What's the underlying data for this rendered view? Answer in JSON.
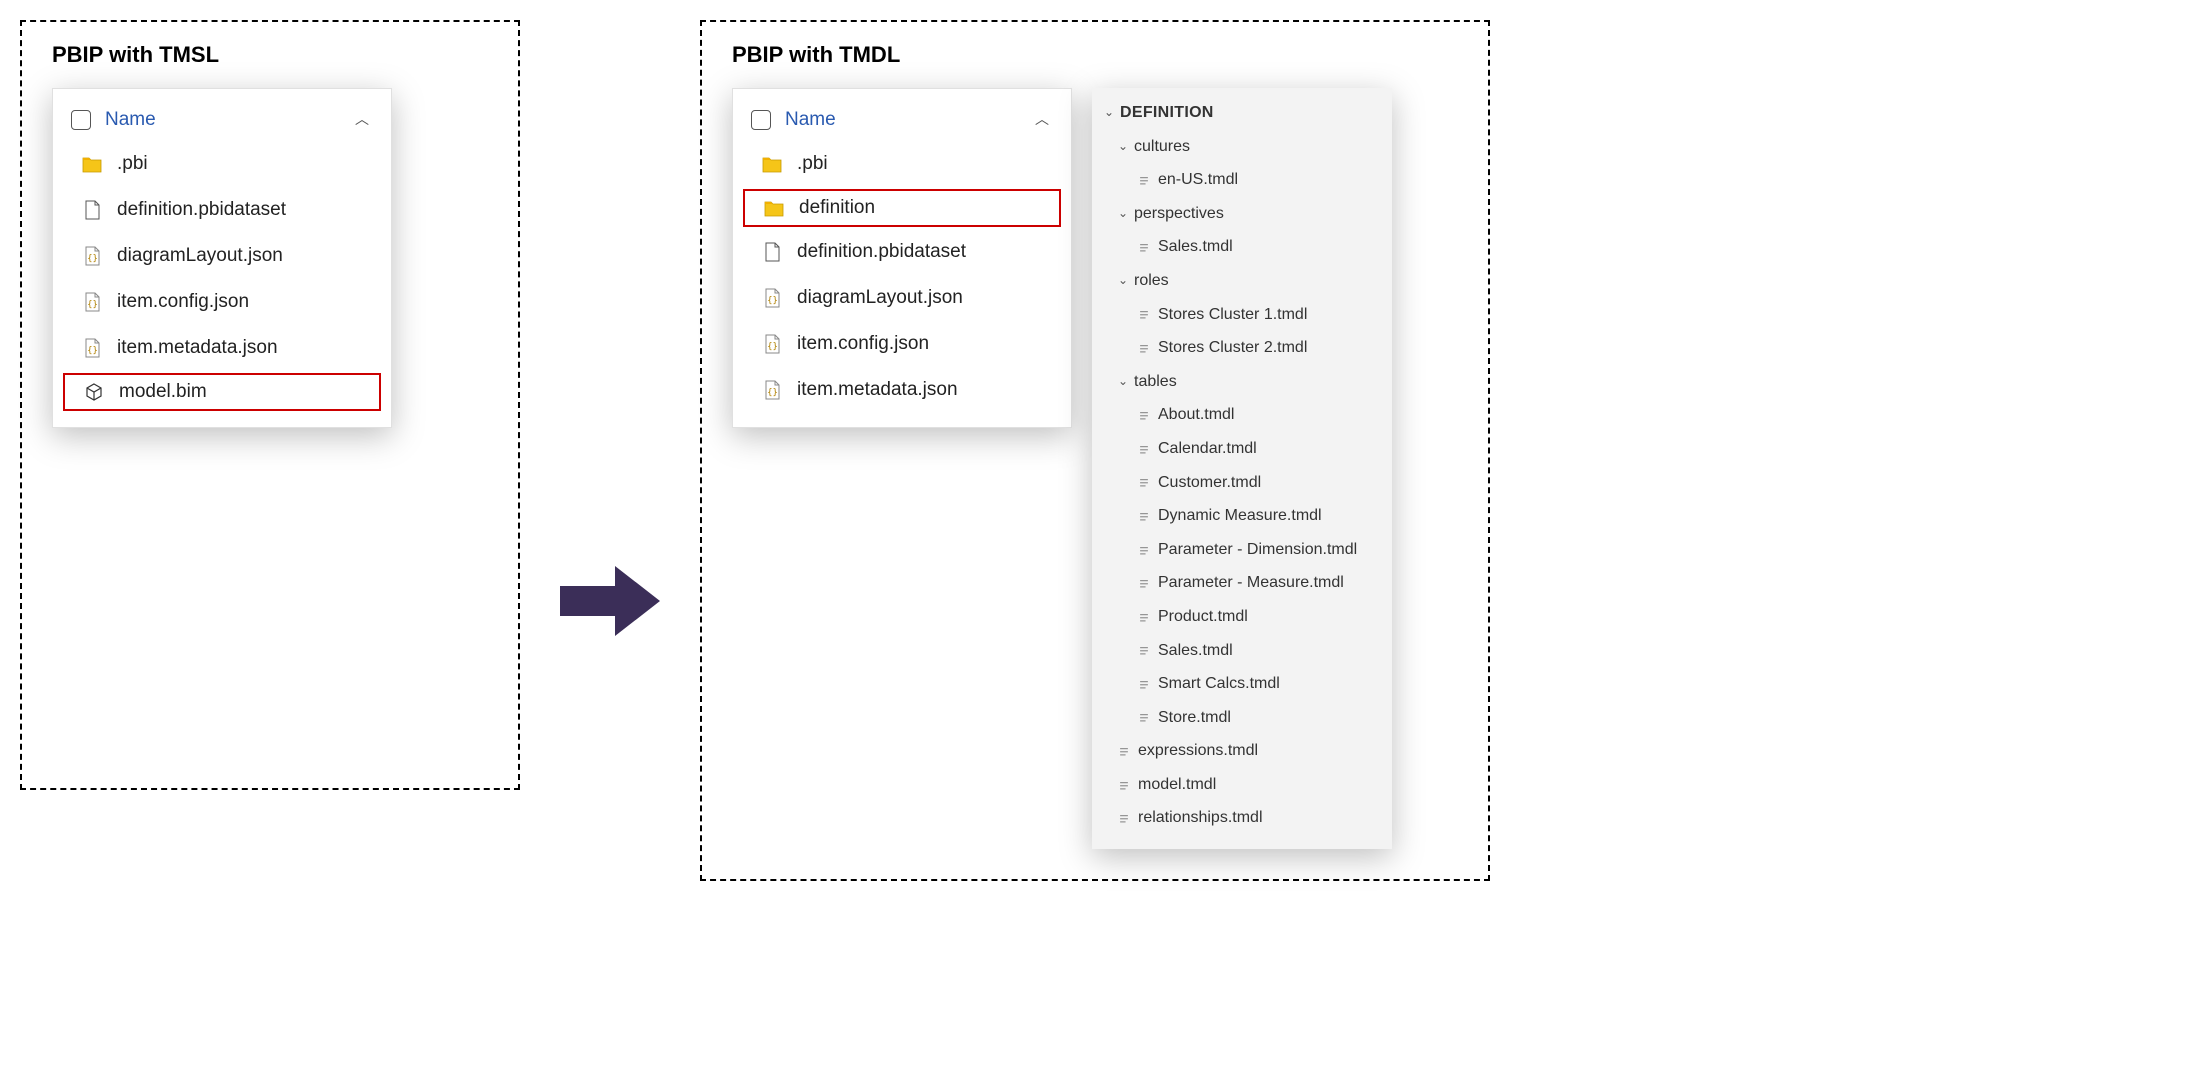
{
  "left": {
    "title": "PBIP with TMSL",
    "header": "Name",
    "rows": [
      {
        "icon": "folder",
        "label": ".pbi",
        "highlight": false
      },
      {
        "icon": "doc",
        "label": "definition.pbidataset",
        "highlight": false
      },
      {
        "icon": "json",
        "label": "diagramLayout.json",
        "highlight": false
      },
      {
        "icon": "json",
        "label": "item.config.json",
        "highlight": false
      },
      {
        "icon": "json",
        "label": "item.metadata.json",
        "highlight": false
      },
      {
        "icon": "bim",
        "label": "model.bim",
        "highlight": true
      }
    ]
  },
  "right": {
    "title": "PBIP with TMDL",
    "header": "Name",
    "rows": [
      {
        "icon": "folder",
        "label": ".pbi",
        "highlight": false
      },
      {
        "icon": "folder",
        "label": "definition",
        "highlight": true
      },
      {
        "icon": "doc",
        "label": "definition.pbidataset",
        "highlight": false
      },
      {
        "icon": "json",
        "label": "diagramLayout.json",
        "highlight": false
      },
      {
        "icon": "json",
        "label": "item.config.json",
        "highlight": false
      },
      {
        "icon": "json",
        "label": "item.metadata.json",
        "highlight": false
      }
    ],
    "tree": {
      "root": "DEFINITION",
      "folders": [
        {
          "name": "cultures",
          "files": [
            "en-US.tmdl"
          ]
        },
        {
          "name": "perspectives",
          "files": [
            "Sales.tmdl"
          ]
        },
        {
          "name": "roles",
          "files": [
            "Stores Cluster 1.tmdl",
            "Stores Cluster 2.tmdl"
          ]
        },
        {
          "name": "tables",
          "files": [
            "About.tmdl",
            "Calendar.tmdl",
            "Customer.tmdl",
            "Dynamic Measure.tmdl",
            "Parameter - Dimension.tmdl",
            "Parameter - Measure.tmdl",
            "Product.tmdl",
            "Sales.tmdl",
            "Smart Calcs.tmdl",
            "Store.tmdl"
          ]
        }
      ],
      "rootFiles": [
        "expressions.tmdl",
        "model.tmdl",
        "relationships.tmdl"
      ]
    }
  }
}
